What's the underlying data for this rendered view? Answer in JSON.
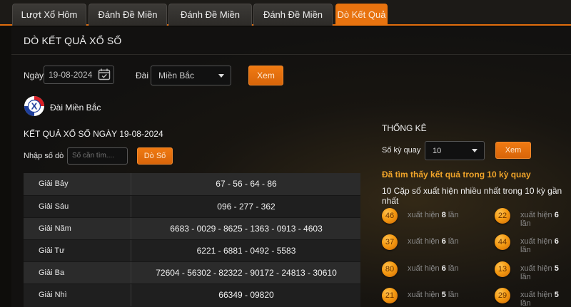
{
  "tabs": [
    {
      "label": "Lượt Xổ Hôm Nay"
    },
    {
      "label": "Đánh Đề Miền Bắc"
    },
    {
      "label": "Đánh Đề Miền Trung"
    },
    {
      "label": "Đánh Đề Miền Nam"
    },
    {
      "label": "Dò Kết Quả",
      "active": true
    }
  ],
  "page_title": "DÒ KẾT QUẢ XỔ SỐ",
  "search": {
    "date_label": "Ngày",
    "date_value": "19-08-2024",
    "station_label": "Đài",
    "station_value": "Miền Bắc",
    "view_button": "Xem"
  },
  "station": {
    "name": "Đài Miền Bắc",
    "logo_letter": "X"
  },
  "results": {
    "title": "KẾT QUẢ XỔ SỐ NGÀY 19-08-2024",
    "lookup_label": "Nhập số dò",
    "lookup_placeholder": "Số cần tìm....",
    "lookup_button": "Dò Số",
    "rows": [
      {
        "prize": "Giải Bảy",
        "numbers": "67 - 56 - 64 - 86"
      },
      {
        "prize": "Giải Sáu",
        "numbers": "096 - 277 - 362"
      },
      {
        "prize": "Giải Năm",
        "numbers": "6683 - 0029 - 8625 - 1363 - 0913 - 4603"
      },
      {
        "prize": "Giải Tư",
        "numbers": "6221 - 6881 - 0492 - 5583"
      },
      {
        "prize": "Giải Ba",
        "numbers": "72604 - 56302 - 82322 - 90172 - 24813 - 30610"
      },
      {
        "prize": "Giải Nhì",
        "numbers": "66349 - 09820"
      }
    ]
  },
  "stats": {
    "title": "THỐNG KÊ",
    "periods_label": "Số kỳ quay",
    "periods_value": "10",
    "view_button": "Xem",
    "found_text": "Đã tìm thấy kết quả trong 10 kỳ quay",
    "subtitle": "10 Cặp số xuất hiện nhiều nhất trong 10 kỳ gần nhất",
    "appear_prefix": "xuất hiện",
    "appear_suffix": "lần",
    "pairs": [
      {
        "number": "46",
        "count": "8"
      },
      {
        "number": "22",
        "count": "6"
      },
      {
        "number": "37",
        "count": "6"
      },
      {
        "number": "44",
        "count": "6"
      },
      {
        "number": "80",
        "count": "6"
      },
      {
        "number": "13",
        "count": "5"
      },
      {
        "number": "21",
        "count": "5"
      },
      {
        "number": "29",
        "count": "5"
      }
    ]
  },
  "colors": {
    "accent": "#e8730f",
    "ball": "#f49a12",
    "found_text": "#f0a42a"
  }
}
